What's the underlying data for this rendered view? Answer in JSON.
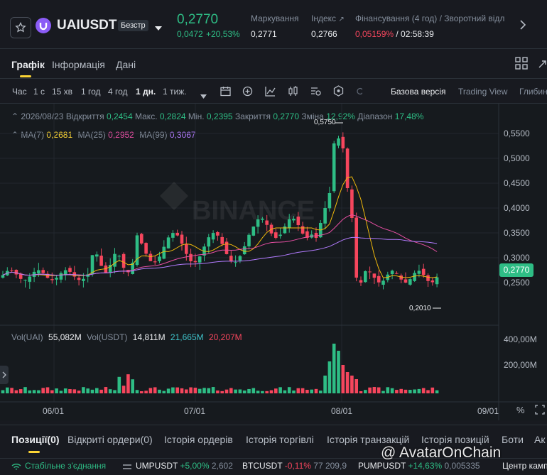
{
  "header": {
    "symbol": "UAIUSDT",
    "badge": "Безстр",
    "last_price": "0,2770",
    "change_abs": "0,0472",
    "change_pct": "+20,53%",
    "stats": [
      {
        "label": "Маркування",
        "value": "0,2771"
      },
      {
        "label": "Індекс",
        "value": "0,2766"
      },
      {
        "label": "Фінансування (4 год) / Зворотний відл",
        "value_red": "0,05159%",
        "value_rest": "/ 02:58:39"
      }
    ]
  },
  "tabs": {
    "chart": "Графік",
    "info": "Інформація",
    "data": "Дані"
  },
  "toolbar": {
    "intervals": [
      "Час",
      "1 с",
      "15 хв",
      "1 год",
      "4 год",
      "1 дн.",
      "1 тиж."
    ],
    "active_interval": "1 дн.",
    "views": [
      "Базова версія",
      "Trading View",
      "Глибин"
    ]
  },
  "ohlc": {
    "date": "2026/08/23",
    "open_label": "Відкриття",
    "open": "0,2454",
    "high_label": "Макс.",
    "high": "0,2824",
    "low_label": "Мін.",
    "low": "0,2395",
    "close_label": "Закриття",
    "close": "0,2770",
    "change_label": "Зміна",
    "change": "12,92%",
    "range_label": "Діапазон",
    "range": "17,48%"
  },
  "ma": {
    "ma7_label": "MA(7)",
    "ma7": "0,2681",
    "ma25_label": "MA(25)",
    "ma25": "0,2952",
    "ma99_label": "MA(99)",
    "ma99": "0,3067"
  },
  "vol": {
    "uai_label": "Vol(UAI)",
    "uai": "55,082M",
    "usdt_label": "Vol(USDT)",
    "usdt": "14,811M",
    "v1": "21,665M",
    "v2": "20,207M"
  },
  "price_axis": [
    "0,5500",
    "0,5000",
    "0,4500",
    "0,4000",
    "0,3500",
    "0,3000",
    "0,2500"
  ],
  "price_tag": "0,2770",
  "high_marker": "0,5750",
  "low_marker": "0,2010",
  "vol_axis": [
    "400,00M",
    "200,00M"
  ],
  "date_axis": [
    "06/01",
    "07/01",
    "08/01",
    "09/01"
  ],
  "bottom_tabs": [
    "Позиції(0)",
    "Відкриті ордери(0)",
    "Історія ордерів",
    "Історія торгівлі",
    "Історія транзакцій",
    "Історія позицій",
    "Боти",
    "Ак"
  ],
  "status": {
    "connection": "Стабільне з'єднання",
    "tickers": [
      {
        "sym": "UMPUSDT",
        "chg": "+5,00%",
        "price": "2,602"
      },
      {
        "sym": "BTCUSDT",
        "chg": "-0,11%",
        "price": "77 209,9"
      },
      {
        "sym": "PUMPUSDT",
        "chg": "+14,63%",
        "price": "0,005335"
      }
    ],
    "right": "Центр камп"
  },
  "watermark": "@ AvatarOnChain",
  "colors": {
    "up": "#2ebd85",
    "down": "#f6465d",
    "ma7": "#f0b90b",
    "ma25": "#e84fa4",
    "ma99": "#b27bff",
    "accent": "#fcd535"
  }
}
